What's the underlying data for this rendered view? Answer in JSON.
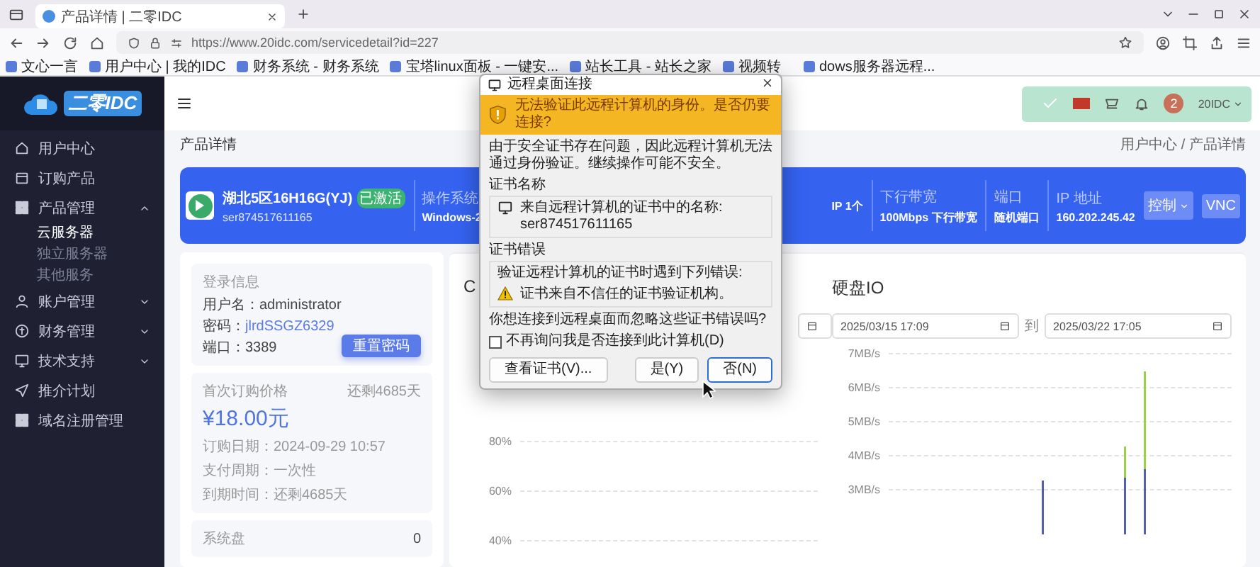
{
  "browser": {
    "tab_title": "产品详情 | 二零IDC",
    "url": "https://www.20idc.com/servicedetail?id=227",
    "bookmarks": [
      {
        "label": "文心一言"
      },
      {
        "label": "用户中心 | 我的IDC"
      },
      {
        "label": "财务系统 - 财务系统"
      },
      {
        "label": "宝塔linux面板 - 一键安..."
      },
      {
        "label": "站长工具 - 站长之家"
      },
      {
        "label": "视频转"
      },
      {
        "label": "dows服务器远程..."
      }
    ]
  },
  "sidebar": {
    "logo": "二零IDC",
    "items": [
      {
        "label": "用户中心"
      },
      {
        "label": "订购产品"
      },
      {
        "label": "产品管理",
        "expanded": true,
        "children": [
          {
            "label": "云服务器",
            "selected": true
          },
          {
            "label": "独立服务器",
            "selected": false
          },
          {
            "label": "其他服务",
            "selected": false
          }
        ]
      },
      {
        "label": "账户管理",
        "expanded": false
      },
      {
        "label": "财务管理",
        "expanded": false
      },
      {
        "label": "技术支持",
        "expanded": false
      },
      {
        "label": "推介计划"
      },
      {
        "label": "域名注册管理"
      }
    ]
  },
  "header": {
    "user": {
      "avatar_letter": "2",
      "name": "20IDC"
    }
  },
  "page_title": "产品详情",
  "breadcrumb": "用户中心 / 产品详情",
  "banner": {
    "name": "湖北5区16H16G(YJ)",
    "status": "已激活",
    "id": "ser874517611165",
    "specs": [
      {
        "label": "操作系统",
        "value": "Windows-2"
      },
      {
        "value": "IP 1个"
      },
      {
        "label": "下行带宽",
        "value": "100Mbps 下行带宽"
      },
      {
        "label": "端口",
        "value": "随机端口"
      },
      {
        "label": "IP 地址",
        "value": "160.202.245.42"
      }
    ],
    "buttons": [
      {
        "label": "控制",
        "kind": "dropdown"
      },
      {
        "label": "VNC",
        "kind": "plain"
      }
    ]
  },
  "login": {
    "title": "登录信息",
    "fields": [
      {
        "label": "用户名：",
        "value": "administrator",
        "kind": "text"
      },
      {
        "label": "密码：",
        "value": "jlrdSSGZ6329",
        "kind": "link"
      },
      {
        "label": "端口：",
        "value": "3389",
        "kind": "text"
      }
    ],
    "button": "重置密码"
  },
  "price": {
    "title": "首次订购价格",
    "remaining": "还剩4685天",
    "amount": "¥18.00元",
    "rows": [
      "订购日期：2024-09-29 10:57",
      "支付周期：一次性",
      "到期时间：还剩4685天"
    ]
  },
  "disk": {
    "label": "系统盘",
    "value": "0"
  },
  "charts": [
    {
      "title": "C",
      "y_ticks": [
        "80%",
        "60%",
        "40%"
      ]
    },
    {
      "title": "硬盘IO",
      "dates": [
        "2025/03/15  17:09",
        "2025/03/22  17:05"
      ],
      "separator": "到",
      "y_ticks": [
        "7MB/s",
        "6MB/s",
        "5MB/s",
        "4MB/s",
        "3MB/s"
      ]
    }
  ],
  "dialog": {
    "title": "远程桌面连接",
    "warning": "无法验证此远程计算机的身份。是否仍要连接?",
    "message": "由于安全证书存在问题，因此远程计算机无法通过身份验证。继续操作可能不安全。",
    "groups": [
      {
        "title": "证书名称",
        "kind": "name",
        "intro": "来自远程计算机的证书中的名称:",
        "line": "ser874517611165"
      },
      {
        "title": "证书错误",
        "kind": "error",
        "intro": "验证远程计算机的证书时遇到下列错误:",
        "line": "证书来自不信任的证书验证机构。"
      }
    ],
    "question": "你想连接到远程桌面而忽略这些证书错误吗?",
    "checkbox": {
      "label": "不再询问我是否连接到此计算机(D)",
      "checked": false
    },
    "buttons": [
      {
        "label": "查看证书(V)...",
        "selected": false
      },
      {
        "label": "是(Y)",
        "selected": false
      },
      {
        "label": "否(N)",
        "selected": true
      }
    ]
  }
}
